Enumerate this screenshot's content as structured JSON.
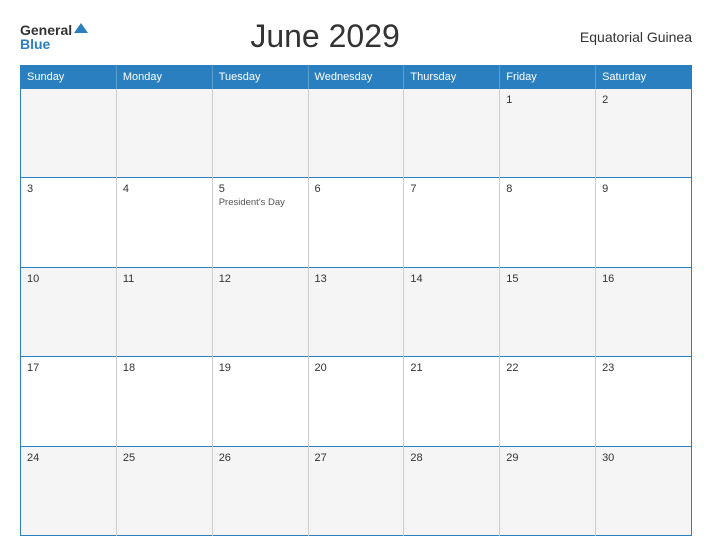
{
  "header": {
    "logo_general": "General",
    "logo_blue": "Blue",
    "title": "June 2029",
    "country": "Equatorial Guinea"
  },
  "days": [
    "Sunday",
    "Monday",
    "Tuesday",
    "Wednesday",
    "Thursday",
    "Friday",
    "Saturday"
  ],
  "weeks": [
    [
      {
        "day": "",
        "event": ""
      },
      {
        "day": "",
        "event": ""
      },
      {
        "day": "",
        "event": ""
      },
      {
        "day": "",
        "event": ""
      },
      {
        "day": "",
        "event": ""
      },
      {
        "day": "1",
        "event": ""
      },
      {
        "day": "2",
        "event": ""
      }
    ],
    [
      {
        "day": "3",
        "event": ""
      },
      {
        "day": "4",
        "event": ""
      },
      {
        "day": "5",
        "event": "President's Day"
      },
      {
        "day": "6",
        "event": ""
      },
      {
        "day": "7",
        "event": ""
      },
      {
        "day": "8",
        "event": ""
      },
      {
        "day": "9",
        "event": ""
      }
    ],
    [
      {
        "day": "10",
        "event": ""
      },
      {
        "day": "11",
        "event": ""
      },
      {
        "day": "12",
        "event": ""
      },
      {
        "day": "13",
        "event": ""
      },
      {
        "day": "14",
        "event": ""
      },
      {
        "day": "15",
        "event": ""
      },
      {
        "day": "16",
        "event": ""
      }
    ],
    [
      {
        "day": "17",
        "event": ""
      },
      {
        "day": "18",
        "event": ""
      },
      {
        "day": "19",
        "event": ""
      },
      {
        "day": "20",
        "event": ""
      },
      {
        "day": "21",
        "event": ""
      },
      {
        "day": "22",
        "event": ""
      },
      {
        "day": "23",
        "event": ""
      }
    ],
    [
      {
        "day": "24",
        "event": ""
      },
      {
        "day": "25",
        "event": ""
      },
      {
        "day": "26",
        "event": ""
      },
      {
        "day": "27",
        "event": ""
      },
      {
        "day": "28",
        "event": ""
      },
      {
        "day": "29",
        "event": ""
      },
      {
        "day": "30",
        "event": ""
      }
    ]
  ]
}
